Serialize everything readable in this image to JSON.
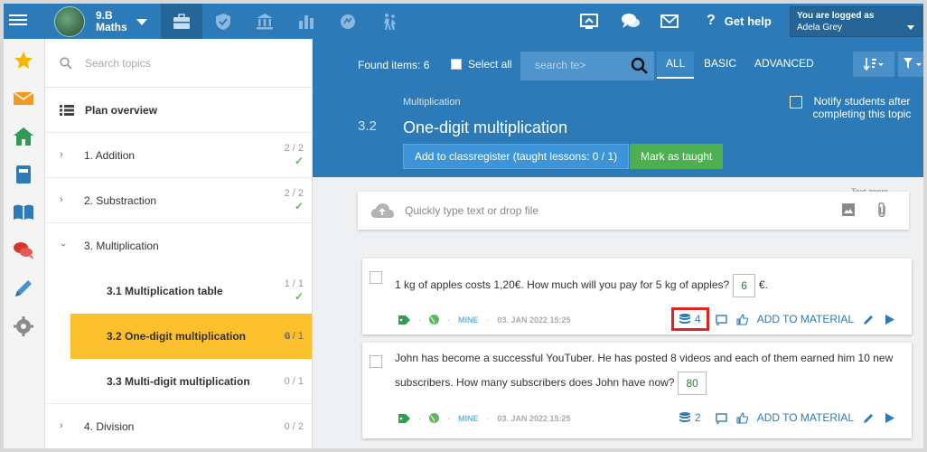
{
  "topbar": {
    "class_line1": "9.B",
    "class_line2": "Maths",
    "help_label": "Get help",
    "user_status": "You are logged as",
    "user_name": "Adela Grey"
  },
  "sidebar": {
    "search_placeholder": "Search topics",
    "plan_label": "Plan overview",
    "items": [
      {
        "label": "1. Addition",
        "count": "2 / 2",
        "done": "✓"
      },
      {
        "label": "2. Substraction",
        "count": "2 / 2",
        "done": "✓"
      },
      {
        "label": "3. Multiplication",
        "count": ""
      }
    ],
    "subitems": [
      {
        "label": "3.1  Multiplication table",
        "count": "1 / 1",
        "done": "✓"
      },
      {
        "label": "3.2  One-digit multiplication",
        "count": "0 / 1",
        "mini": "6"
      },
      {
        "label": "3.3  Multi-digit multiplication",
        "count": "0 / 1"
      }
    ],
    "last": {
      "label": "4. Division",
      "count": "0 / 2"
    }
  },
  "main": {
    "found": "Found items: 6",
    "select_all": "Select all",
    "search_placeholder": "search te>",
    "filters": [
      "ALL",
      "BASIC",
      "ADVANCED"
    ],
    "subject": "Multiplication",
    "topic_number": "3.2",
    "topic_title": "One-digit multiplication",
    "btn_classregister": "Add to classregister (taught lessons: 0 / 1)",
    "btn_taught": "Mark as taught",
    "notify": "Notify students after completing this topic",
    "text_zoom": "Text zoom",
    "upload_placeholder": "Quickly type text or drop file"
  },
  "cards": [
    {
      "q_before": "1 kg of apples costs 1,20€. How much will you pay for 5 kg of apples?",
      "answer": "6",
      "q_after": "€.",
      "sep": "·",
      "mine": "MINE",
      "date": "03. JAN 2022 15:25",
      "db_count": "4",
      "add_material": "ADD TO MATERIAL"
    },
    {
      "q_line1": "John has become a successful YouTuber. He has posted 8 videos and each of them earned him 10 new",
      "q_line2": "subscribers. How many subscribers does John have now?",
      "answer": "80",
      "sep": "·",
      "mine": "MINE",
      "date": "03. JAN 2022 15:25",
      "db_count": "2",
      "add_material": "ADD TO MATERIAL"
    }
  ],
  "colors": {
    "topbar": "#2d7ab9",
    "active_topic": "#fcbf2e",
    "taught_green": "#4caf50",
    "highlight": "#e32222"
  }
}
